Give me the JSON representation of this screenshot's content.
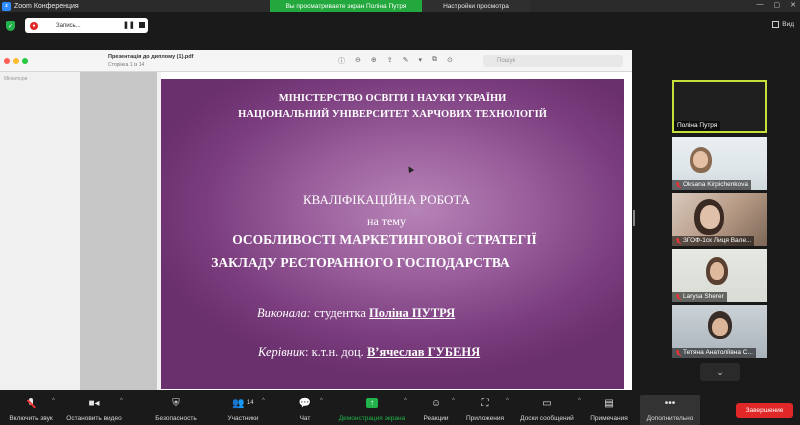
{
  "window": {
    "title": "Zoom Конференция",
    "share_banner": "Вы просматриваете экран Поліна Путря",
    "view_settings": "Настройки просмотра",
    "view_label": "Вид",
    "app_icon": "zoom-icon"
  },
  "recording": {
    "label": "Запись...",
    "status_color": "#e02828"
  },
  "pdf": {
    "filename": "Презентація до диплому (1).pdf",
    "pages": "Сторінка 1 із 14",
    "search_placeholder": "Пошук",
    "sidebar_label": "Мініатюри"
  },
  "slide": {
    "ministry": "МІНІСТЕРСТВО ОСВІТИ І НАУКИ УКРАЇНИ",
    "university": "НАЦІОНАЛЬНИЙ  УНІВЕРСИТЕТ ХАРЧОВИХ ТЕХНОЛОГІЙ",
    "work": "КВАЛІФІКАЦІЙНА РОБОТА",
    "na_temu": "на тему",
    "topic_line1": "ОСОБЛИВОСТІ МАРКЕТИНГОВОЇ СТРАТЕГІЇ",
    "topic_line2": "ЗАКЛАДУ РЕСТОРАННОГО ГОСПОДАРСТВА",
    "performed_label": "Виконала:",
    "performed_role": " студентка ",
    "performed_name": "Поліна  ПУТРЯ",
    "supervisor_label": "Керівник",
    "supervisor_role": ": к.т.н. доц. ",
    "supervisor_name": "В’ячеслав ГУБЕНЯ"
  },
  "participants": [
    {
      "name": "Поліна Путря",
      "muted": false
    },
    {
      "name": "Oksana Kirpichenkova",
      "muted": true
    },
    {
      "name": "ЗГОФ-1ск Лиця Вале...",
      "muted": true
    },
    {
      "name": "Larysa Sherer",
      "muted": true
    },
    {
      "name": "Тетяна Анатоліївна С...",
      "muted": true
    }
  ],
  "controls": {
    "mute": "Включить звук",
    "video": "Остановить видео",
    "security": "Безопасность",
    "participants": "Участники",
    "participants_count": "14",
    "chat": "Чат",
    "share": "Демонстрация экрана",
    "reactions": "Реакции",
    "apps": "Приложения",
    "whiteboard": "Доски сообщений",
    "notes": "Примечания",
    "more": "Дополнительно",
    "end": "Завершение"
  },
  "colors": {
    "share_green": "#21b24b",
    "end_red": "#e02828",
    "active_speaker": "#c7df3a",
    "slide_purple": "#7b3d7e"
  }
}
